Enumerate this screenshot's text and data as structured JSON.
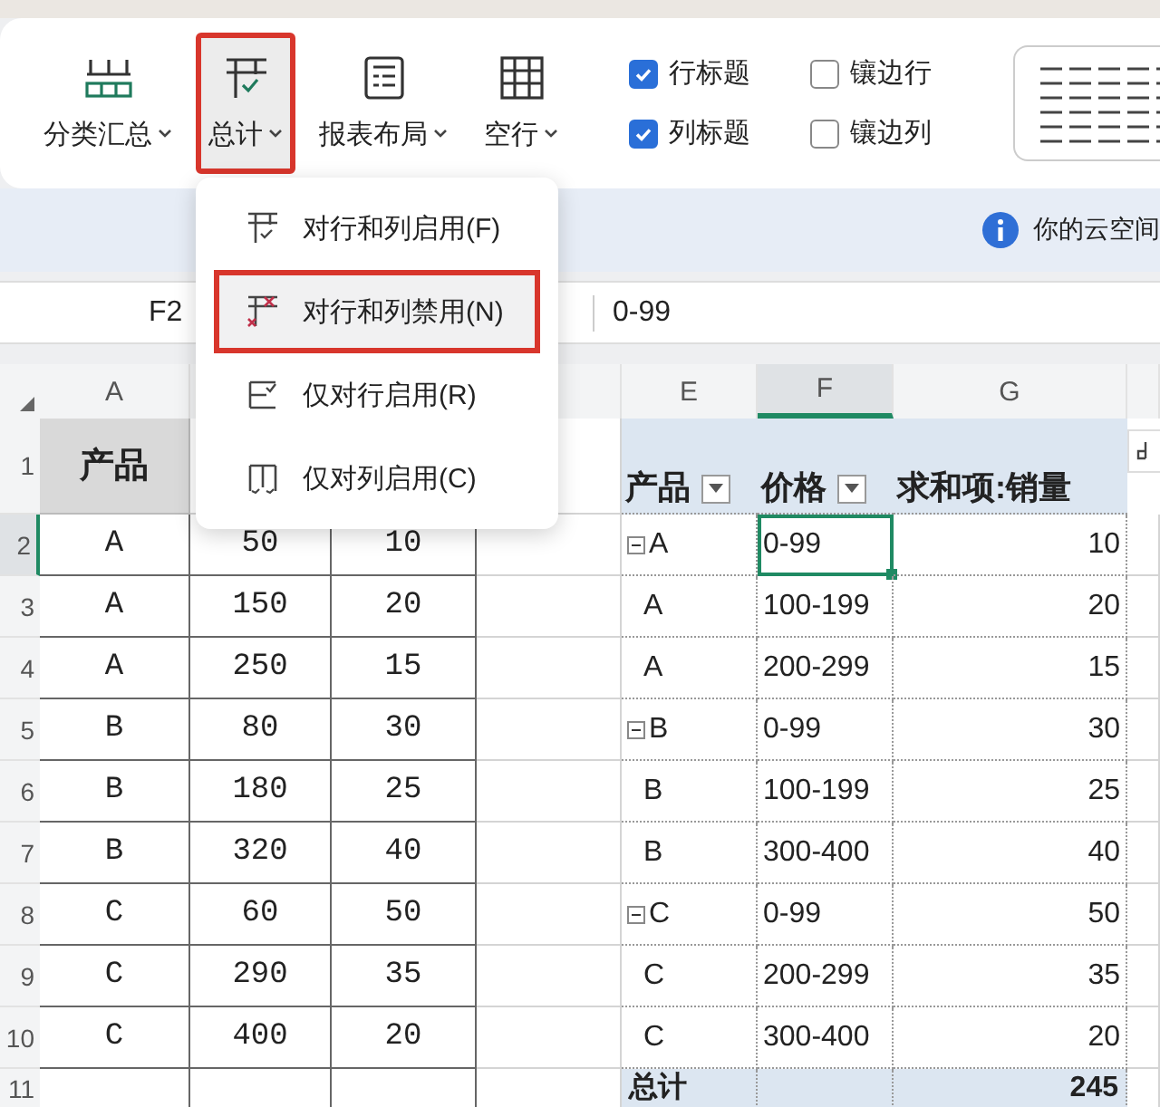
{
  "ribbon": {
    "buttons": [
      {
        "label": "分类汇总",
        "kind": "subtotals",
        "selected": false
      },
      {
        "label": "总计",
        "kind": "grand-totals",
        "selected": true
      },
      {
        "label": "报表布局",
        "kind": "layout",
        "selected": false
      },
      {
        "label": "空行",
        "kind": "blank-rows",
        "selected": false
      }
    ],
    "options": [
      {
        "label": "行标题",
        "checked": true
      },
      {
        "label": "镶边行",
        "checked": false
      },
      {
        "label": "列标题",
        "checked": true
      },
      {
        "label": "镶边列",
        "checked": false
      }
    ]
  },
  "info_bar": {
    "text": "你的云空间"
  },
  "formula_bar": {
    "cell": "F2",
    "value": "0-99"
  },
  "columns": [
    {
      "label": "A",
      "selected": false
    },
    {},
    {},
    {},
    {
      "label": "E",
      "selected": false
    },
    {
      "label": "F",
      "selected": true
    },
    {
      "label": "G",
      "selected": false
    },
    {
      "selected": false
    }
  ],
  "rows": [
    {
      "number": "1",
      "selected": false,
      "cells": [
        {
          "kind": "header",
          "text": "产品"
        },
        {},
        {},
        {},
        {
          "kind": "pivot-header",
          "text": "产品",
          "filter": true
        },
        {
          "kind": "pivot-header",
          "text": "价格",
          "filter": true
        },
        {
          "kind": "pivot-header",
          "text": "求和项:销量"
        },
        {
          "kind": "tool"
        }
      ]
    },
    {
      "number": "2",
      "selected": true,
      "cells": [
        {
          "kind": "source",
          "text": "A"
        },
        {
          "kind": "source",
          "text": "50"
        },
        {
          "kind": "source",
          "text": "10"
        },
        {},
        {
          "kind": "group",
          "text": "A",
          "expanded": true
        },
        {
          "kind": "text",
          "text": "0-99"
        },
        {
          "kind": "number",
          "text": "10"
        },
        {}
      ]
    },
    {
      "number": "3",
      "selected": false,
      "cells": [
        {
          "kind": "source",
          "text": "A"
        },
        {
          "kind": "source",
          "text": "150"
        },
        {
          "kind": "source",
          "text": "20"
        },
        {},
        {
          "kind": "item",
          "text": "A"
        },
        {
          "kind": "text",
          "text": "100-199"
        },
        {
          "kind": "number",
          "text": "20"
        },
        {}
      ]
    },
    {
      "number": "4",
      "selected": false,
      "cells": [
        {
          "kind": "source",
          "text": "A"
        },
        {
          "kind": "source",
          "text": "250"
        },
        {
          "kind": "source",
          "text": "15"
        },
        {},
        {
          "kind": "item",
          "text": "A"
        },
        {
          "kind": "text",
          "text": "200-299"
        },
        {
          "kind": "number",
          "text": "15"
        },
        {}
      ]
    },
    {
      "number": "5",
      "selected": false,
      "cells": [
        {
          "kind": "source",
          "text": "B"
        },
        {
          "kind": "source",
          "text": "80"
        },
        {
          "kind": "source",
          "text": "30"
        },
        {},
        {
          "kind": "group",
          "text": "B",
          "expanded": true
        },
        {
          "kind": "text",
          "text": "0-99"
        },
        {
          "kind": "number",
          "text": "30"
        },
        {}
      ]
    },
    {
      "number": "6",
      "selected": false,
      "cells": [
        {
          "kind": "source",
          "text": "B"
        },
        {
          "kind": "source",
          "text": "180"
        },
        {
          "kind": "source",
          "text": "25"
        },
        {},
        {
          "kind": "item",
          "text": "B"
        },
        {
          "kind": "text",
          "text": "100-199"
        },
        {
          "kind": "number",
          "text": "25"
        },
        {}
      ]
    },
    {
      "number": "7",
      "selected": false,
      "cells": [
        {
          "kind": "source",
          "text": "B"
        },
        {
          "kind": "source",
          "text": "320"
        },
        {
          "kind": "source",
          "text": "40"
        },
        {},
        {
          "kind": "item",
          "text": "B"
        },
        {
          "kind": "text",
          "text": "300-400"
        },
        {
          "kind": "number",
          "text": "40"
        },
        {}
      ]
    },
    {
      "number": "8",
      "selected": false,
      "cells": [
        {
          "kind": "source",
          "text": "C"
        },
        {
          "kind": "source",
          "text": "60"
        },
        {
          "kind": "source",
          "text": "50"
        },
        {},
        {
          "kind": "group",
          "text": "C",
          "expanded": true
        },
        {
          "kind": "text",
          "text": "0-99"
        },
        {
          "kind": "number",
          "text": "50"
        },
        {}
      ]
    },
    {
      "number": "9",
      "selected": false,
      "cells": [
        {
          "kind": "source",
          "text": "C"
        },
        {
          "kind": "source",
          "text": "290"
        },
        {
          "kind": "source",
          "text": "35"
        },
        {},
        {
          "kind": "item",
          "text": "C"
        },
        {
          "kind": "text",
          "text": "200-299"
        },
        {
          "kind": "number",
          "text": "35"
        },
        {}
      ]
    },
    {
      "number": "10",
      "selected": false,
      "cells": [
        {
          "kind": "source",
          "text": "C"
        },
        {
          "kind": "source",
          "text": "400"
        },
        {
          "kind": "source",
          "text": "20"
        },
        {},
        {
          "kind": "item",
          "text": "C"
        },
        {
          "kind": "text",
          "text": "300-400"
        },
        {
          "kind": "number",
          "text": "20"
        },
        {}
      ]
    },
    {
      "number": "11",
      "selected": false,
      "cells": [
        {},
        {},
        {},
        {},
        {
          "kind": "total-label",
          "text": "总计"
        },
        {
          "kind": "total-blank"
        },
        {
          "kind": "total-value",
          "text": "245"
        },
        {}
      ]
    }
  ],
  "menu": {
    "items": [
      {
        "label": "对行和列启用(F)",
        "kind": "both",
        "selected": false
      },
      {
        "label": "对行和列禁用(N)",
        "kind": "off",
        "selected": true
      },
      {
        "label": "仅对行启用(R)",
        "kind": "rows",
        "selected": false
      },
      {
        "label": "仅对列启用(C)",
        "kind": "columns",
        "selected": false
      }
    ]
  }
}
